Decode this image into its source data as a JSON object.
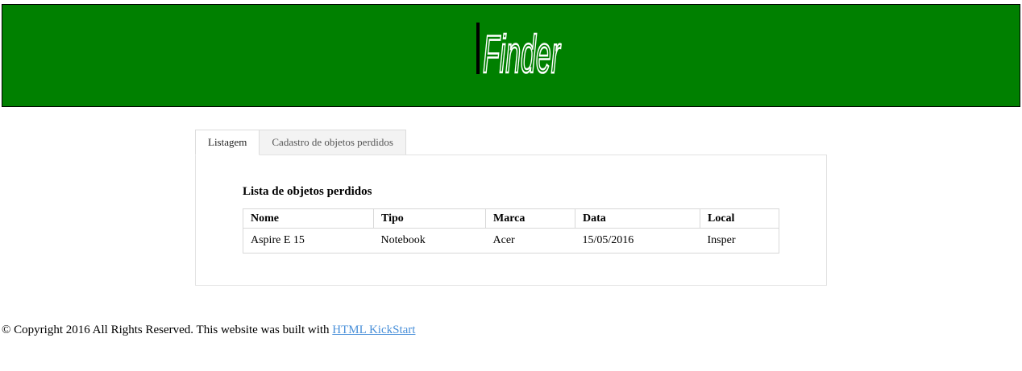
{
  "header": {
    "logo_text": "Finder",
    "background_color": "#008000"
  },
  "tabs": [
    {
      "label": "Listagem",
      "active": true
    },
    {
      "label": "Cadastro de objetos perdidos",
      "active": false
    }
  ],
  "list": {
    "title": "Lista de objetos perdidos",
    "columns": [
      "Nome",
      "Tipo",
      "Marca",
      "Data",
      "Local"
    ],
    "rows": [
      [
        "Aspire E 15",
        "Notebook",
        "Acer",
        "15/05/2016",
        "Insper"
      ]
    ]
  },
  "footer": {
    "text": "© Copyright 2016 All Rights Reserved. This website was built with ",
    "link_label": "HTML KickStart",
    "link_color": "#4a90d9"
  }
}
